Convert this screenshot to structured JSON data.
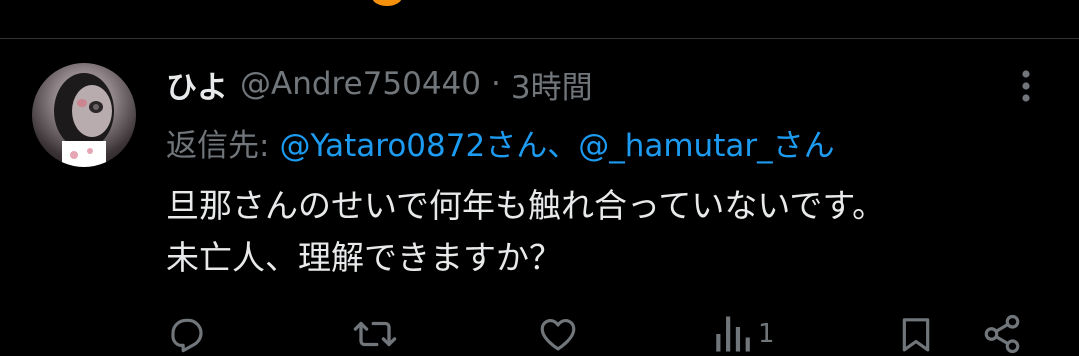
{
  "tweet": {
    "display_name": "ひよ",
    "handle": "@Andre750440",
    "separator": "·",
    "time": "3時間",
    "reply_label": "返信先:",
    "mention_1": "@Yataro0872さん、",
    "mention_2": "@_hamutar_さん",
    "text_lines": [
      "旦那さんのせいで何年も触れ合っていないです。",
      "未亡人、理解できますか？"
    ]
  },
  "actions": {
    "views_count": "1"
  },
  "colors": {
    "background": "#000000",
    "text": "#e7e9ea",
    "secondary": "#71767b",
    "link": "#1d9bf0",
    "divider": "#2f3336"
  }
}
